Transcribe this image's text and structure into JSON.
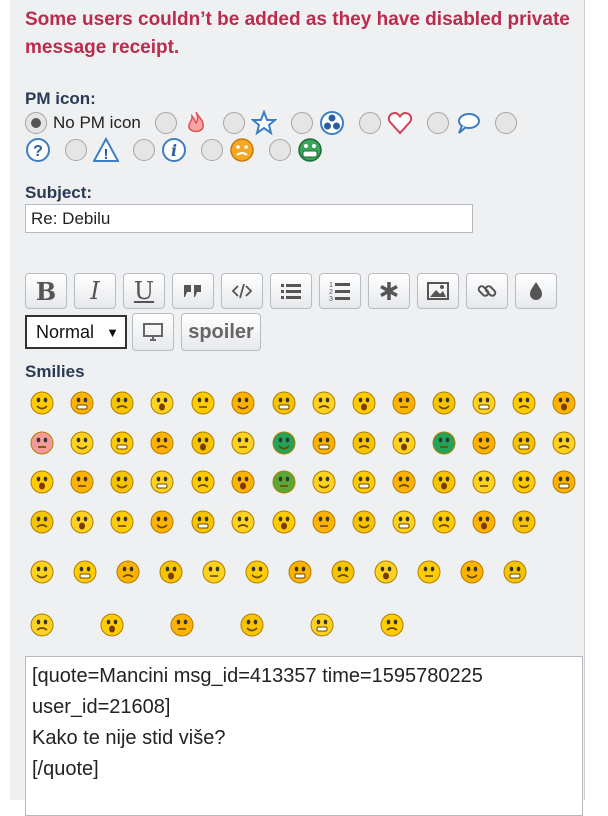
{
  "error_message": "Some users couldn’t be added as they have disabled private message receipt.",
  "pm_icon": {
    "label": "PM icon:",
    "no_icon_label": "No PM icon",
    "selected": "none",
    "row1_icons": [
      "fire-icon",
      "star-icon",
      "radioactive-icon",
      "heart-icon",
      "speech-bubble-icon"
    ],
    "row2_icons": [
      "question-icon",
      "warning-icon",
      "info-icon",
      "sad-face-icon",
      "grin-face-icon"
    ]
  },
  "subject": {
    "label": "Subject:",
    "value": "Re: Debilu"
  },
  "toolbar": {
    "bold": "B",
    "italic": "I",
    "underline": "U",
    "font_size": "Normal",
    "spoiler": "spoiler"
  },
  "smilies": {
    "label": "Smilies",
    "count": 67
  },
  "message": {
    "value": "[quote=Mancini msg_id=413357 time=1595780225 user_id=21608]\nKako te nije stid više?\n[/quote]"
  },
  "colors": {
    "error": "#bc2a4d",
    "label": "#2b3a54",
    "smiley_yellow": "#ffcc00",
    "panel_bg": "#eef0f2"
  }
}
